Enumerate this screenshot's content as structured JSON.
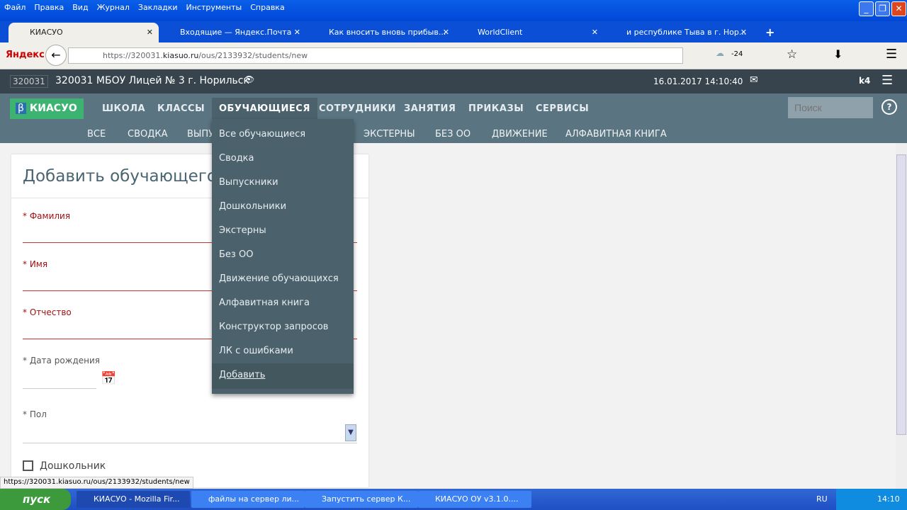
{
  "browser": {
    "menu": [
      "Файл",
      "Правка",
      "Вид",
      "Журнал",
      "Закладки",
      "Инструменты",
      "Справка"
    ],
    "tabs": [
      {
        "title": "КИАСУО",
        "active": true
      },
      {
        "title": "Входящие — Яндекс.Почта"
      },
      {
        "title": "Как вносить вновь прибыв..."
      },
      {
        "title": "WorldClient"
      },
      {
        "title": "и республике Тыва в г. Нор..."
      }
    ],
    "brand": "Яндекс",
    "url_prefix": "https://320031.",
    "url_host": "kiasuo.ru",
    "url_path": "/ous/2133932/students/new",
    "weather": "-24",
    "status_url": "https://320031.kiasuo.ru/ous/2133932/students/new"
  },
  "topbar": {
    "code": "320031",
    "org": "320031 МБОУ Лицей № 3 г. Норильск",
    "datetime": "16.01.2017 14:10:40",
    "user": "k4"
  },
  "nav": {
    "logo": "КИАСУО",
    "beta": "β",
    "items": [
      "ШКОЛА",
      "КЛАССЫ",
      "ОБУЧАЮЩИЕСЯ",
      "СОТРУДНИКИ",
      "ЗАНЯТИЯ",
      "ПРИКАЗЫ",
      "СЕРВИСЫ"
    ],
    "active": "ОБУЧАЮЩИЕСЯ",
    "search_placeholder": "Поиск",
    "sub": [
      "ВСЕ",
      "СВОДКА",
      "ВЫПУ",
      "ЭКСТЕРНЫ",
      "БЕЗ ОО",
      "ДВИЖЕНИЕ",
      "АЛФАВИТНАЯ КНИГА"
    ]
  },
  "dropdown": [
    "Все обучающиеся",
    "Сводка",
    "Выпускники",
    "Дошкольники",
    "Экстерны",
    "Без ОО",
    "Движение обучающихся",
    "Алфавитная книга",
    "Конструктор запросов",
    "ЛК с ошибками",
    "Добавить"
  ],
  "form": {
    "title": "Добавить обучающегося",
    "required": "*",
    "fields": {
      "surname": "Фамилия",
      "name": "Имя",
      "patronymic": "Отчество",
      "birth": "Дата рождения",
      "gender": "Пол"
    },
    "preschool": "Дошкольник"
  },
  "taskbar": {
    "start": "пуск",
    "items": [
      "КИАСУО - Mozilla Fir...",
      "файлы на сервер ли...",
      "Запустить сервер К...",
      "КИАСУО ОУ v3.1.0...."
    ],
    "lang": "RU",
    "clock": "14:10"
  }
}
